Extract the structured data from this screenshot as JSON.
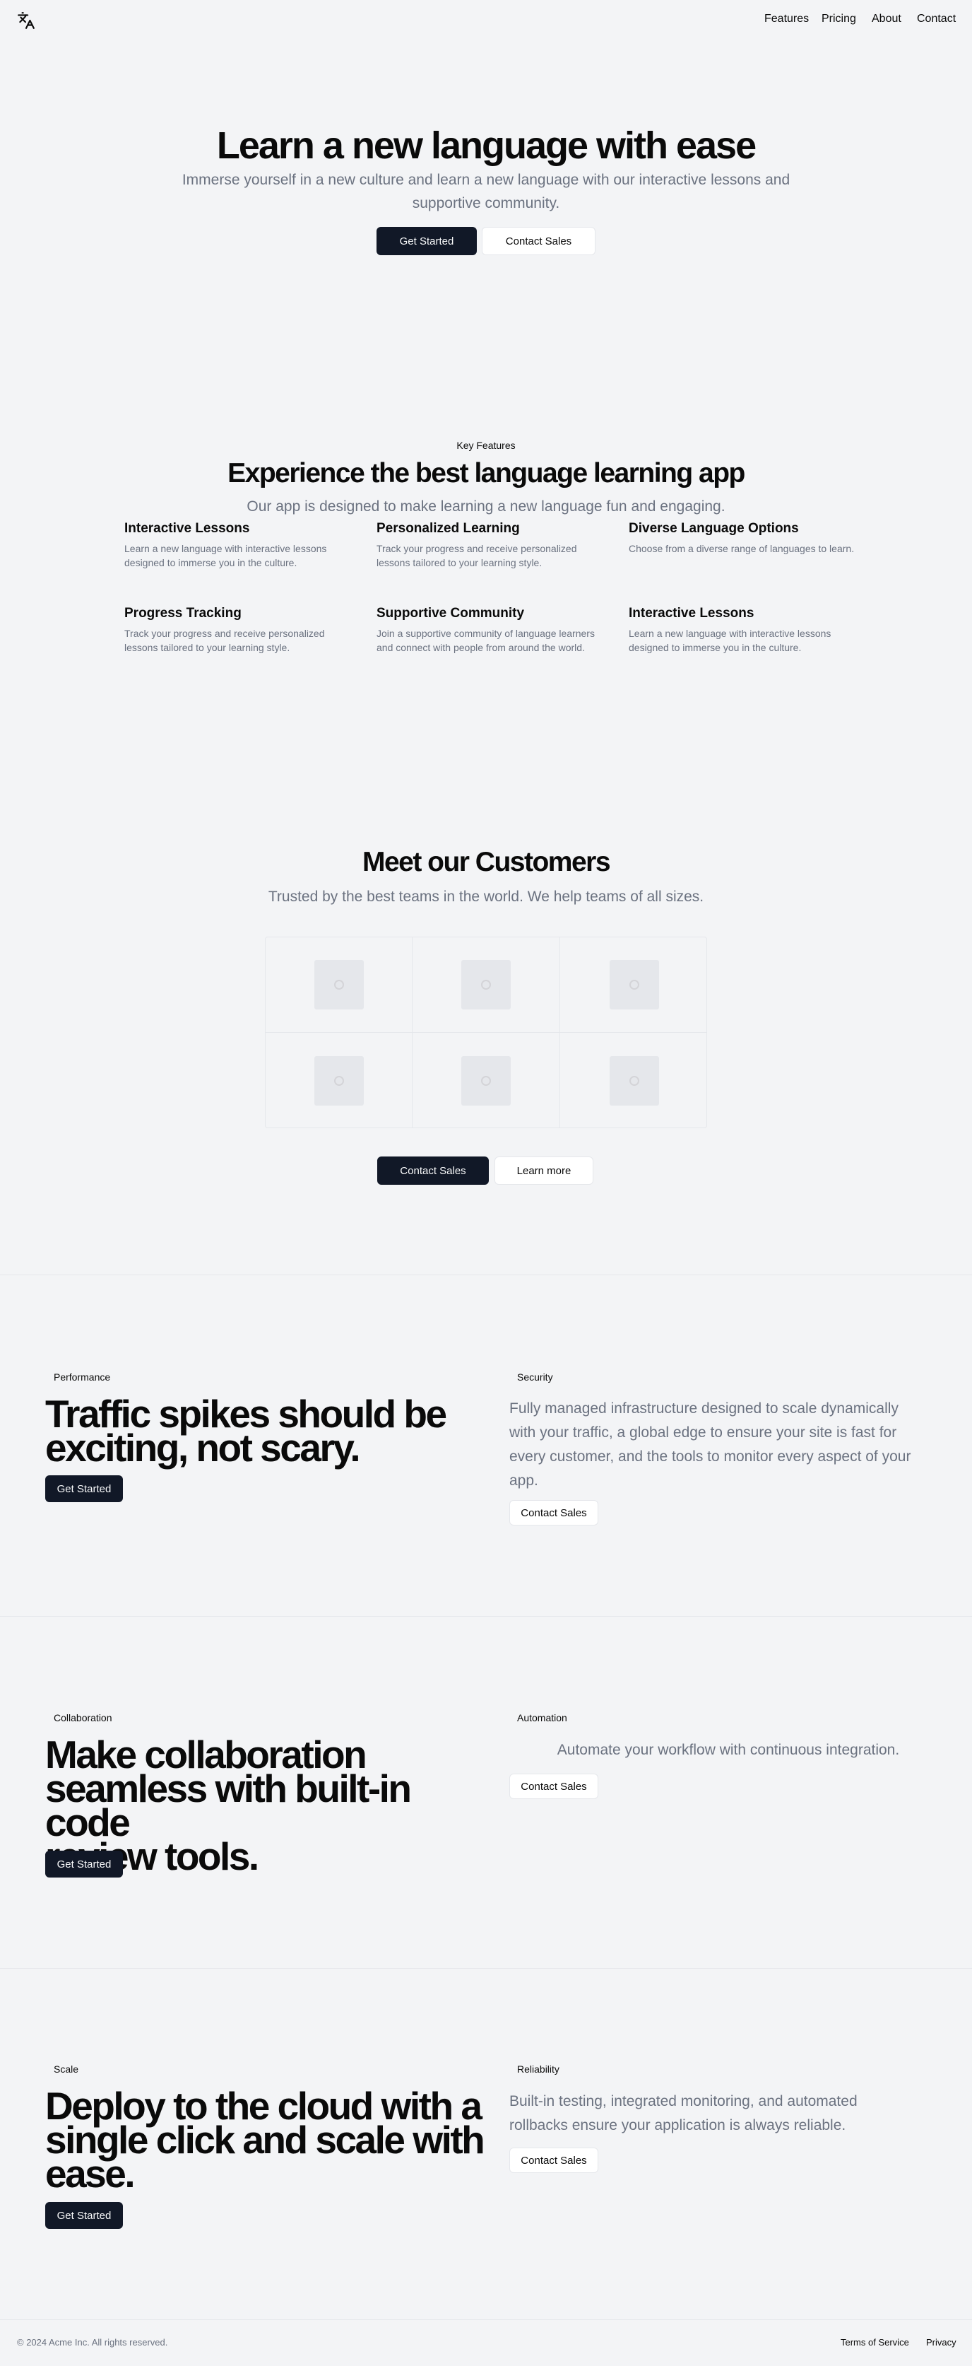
{
  "nav": {
    "logo_icon": "translate-icon",
    "links": [
      "Features",
      "Pricing",
      "About",
      "Contact"
    ]
  },
  "hero": {
    "title": "Learn a new language with ease",
    "subtitle_line1": "Immerse yourself in a new culture and learn a new language with our interactive lessons and",
    "subtitle_line2": "supportive community.",
    "primary": "Get Started",
    "secondary": "Contact Sales"
  },
  "features": {
    "eyebrow": "Key Features",
    "title": "Experience the best language learning app",
    "subtitle": "Our app is designed to make learning a new language fun and engaging.",
    "items": [
      {
        "title": "Interactive Lessons",
        "desc": "Learn a new language with interactive lessons designed to immerse you in the culture."
      },
      {
        "title": "Personalized Learning",
        "desc": "Track your progress and receive personalized lessons tailored to your learning style."
      },
      {
        "title": "Diverse Language Options",
        "desc": "Choose from a diverse range of languages to learn."
      },
      {
        "title": "Progress Tracking",
        "desc": "Track your progress and receive personalized lessons tailored to your learning style."
      },
      {
        "title": "Supportive Community",
        "desc": "Join a supportive community of language learners and connect with people from around the world."
      },
      {
        "title": "Interactive Lessons",
        "desc": "Learn a new language with interactive lessons designed to immerse you in the culture."
      }
    ]
  },
  "customers": {
    "title": "Meet our Customers",
    "subtitle": "Trusted by the best teams in the world. We help teams of all sizes.",
    "primary": "Contact Sales",
    "secondary": "Learn more"
  },
  "sections": [
    {
      "left_badge": "Performance",
      "left_title_lines": [
        "Traffic spikes should be",
        "exciting, not scary."
      ],
      "left_button": "Get Started",
      "right_badge": "Security",
      "right_lines": [
        "Fully managed infrastructure designed to scale dynamically",
        "with your traffic, a global edge to ensure your site is fast for",
        "every customer, and the tools to monitor every aspect of your",
        "app."
      ],
      "right_button": "Contact Sales"
    },
    {
      "left_badge": "Collaboration",
      "left_title_lines": [
        "Make collaboration",
        "seamless with built-in code",
        "review tools."
      ],
      "left_button": "Get Started",
      "right_badge": "Automation",
      "right_lines": [
        "Automate your workflow with continuous integration."
      ],
      "right_button": "Contact Sales"
    },
    {
      "left_badge": "Scale",
      "left_title_lines": [
        "Deploy to the cloud with a",
        "single click and scale with",
        "ease."
      ],
      "left_button": "Get Started",
      "right_badge": "Reliability",
      "right_lines": [
        "Built-in testing, integrated monitoring, and automated",
        "rollbacks ensure your application is always reliable."
      ],
      "right_button": "Contact Sales"
    }
  ],
  "footer": {
    "copyright": "© 2024 Acme Inc. All rights reserved.",
    "links": [
      "Terms of Service",
      "Privacy"
    ]
  }
}
